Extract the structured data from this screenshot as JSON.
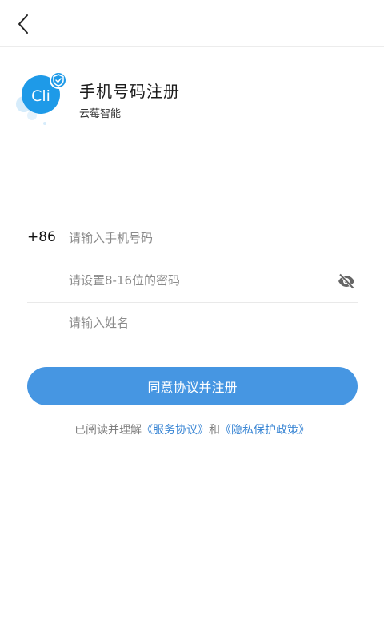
{
  "header": {
    "back_icon": "chevron-left-icon"
  },
  "brand": {
    "title": "手机号码注册",
    "subtitle": "云莓智能",
    "logo_text": "Cli",
    "logo_badge_icon": "shield-check-icon"
  },
  "form": {
    "country_code": "+86",
    "phone_placeholder": "请输入手机号码",
    "password_placeholder": "请设置8-16位的密码",
    "name_placeholder": "请输入姓名",
    "password_visibility_icon": "eye-off-icon"
  },
  "actions": {
    "submit_label": "同意协议并注册"
  },
  "agreement": {
    "prefix": "已阅读并理解",
    "service_link": "《服务协议》",
    "connector": "和",
    "privacy_link": "《隐私保护政策》"
  },
  "colors": {
    "primary": "#4696e2",
    "link": "#3a86d4",
    "logo_blue": "#1e9ae8"
  }
}
